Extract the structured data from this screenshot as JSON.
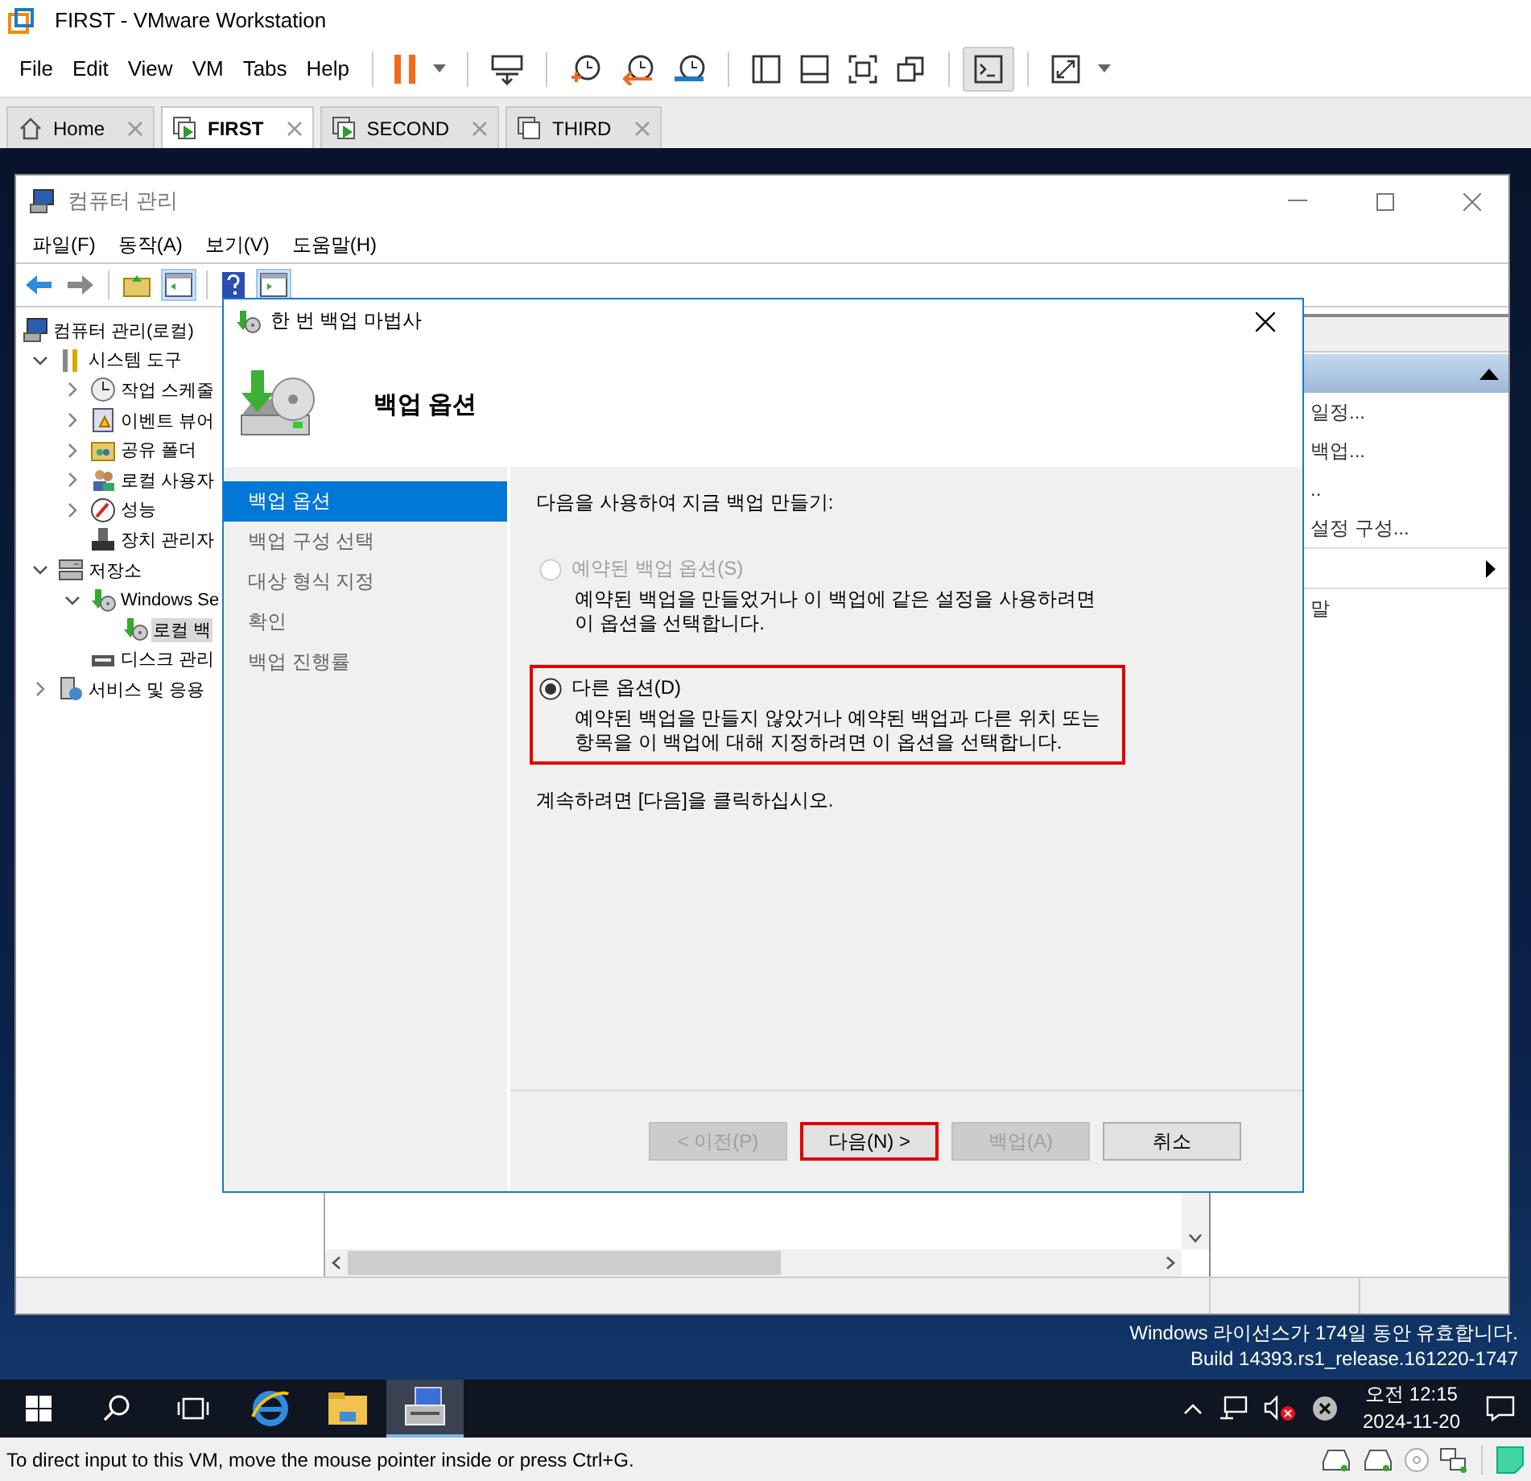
{
  "vmware": {
    "title": "FIRST - VMware Workstation",
    "menu": [
      "File",
      "Edit",
      "View",
      "VM",
      "Tabs",
      "Help"
    ],
    "tabs": [
      {
        "label": "Home",
        "kind": "home",
        "selected": false
      },
      {
        "label": "FIRST",
        "kind": "running",
        "selected": true
      },
      {
        "label": "SECOND",
        "kind": "running",
        "selected": false
      },
      {
        "label": "THIRD",
        "kind": "stopped",
        "selected": false
      }
    ],
    "status": "To direct input to this VM, move the mouse pointer inside or press Ctrl+G."
  },
  "computer_management": {
    "title": "컴퓨터 관리",
    "menu": [
      "파일(F)",
      "동작(A)",
      "보기(V)",
      "도움말(H)"
    ],
    "tree": [
      {
        "label": "컴퓨터 관리(로컬)",
        "kind": "computer",
        "selected": false,
        "children": [
          {
            "label": "시스템 도구",
            "kind": "tools",
            "expanded": true,
            "selected": false,
            "children": [
              {
                "label": "작업 스케줄",
                "kind": "clock",
                "expanded": false,
                "selected": false
              },
              {
                "label": "이벤트 뷰어",
                "kind": "log",
                "expanded": false,
                "selected": false
              },
              {
                "label": "공유 폴더",
                "kind": "share",
                "expanded": false,
                "selected": false
              },
              {
                "label": "로컬 사용자",
                "kind": "users",
                "expanded": false,
                "selected": false
              },
              {
                "label": "성능",
                "kind": "gauge",
                "expanded": false,
                "selected": false
              },
              {
                "label": "장치 관리자",
                "kind": "device",
                "selected": false
              }
            ]
          },
          {
            "label": "저장소",
            "kind": "storage",
            "expanded": true,
            "selected": false,
            "children": [
              {
                "label": "Windows Se",
                "kind": "backup",
                "expanded": true,
                "selected": false,
                "children": [
                  {
                    "label": "로컬 백",
                    "kind": "backup",
                    "selected": true
                  }
                ]
              },
              {
                "label": "디스크 관리",
                "kind": "disk",
                "selected": false
              }
            ]
          },
          {
            "label": "서비스 및 응용",
            "kind": "services",
            "expanded": false,
            "selected": false
          }
        ]
      }
    ],
    "actions": [
      {
        "kind": "section",
        "expanded": true
      },
      {
        "kind": "item",
        "label": "일정..."
      },
      {
        "kind": "item",
        "label": "백업..."
      },
      {
        "kind": "item",
        "label": ".."
      },
      {
        "kind": "item",
        "label": "설정 구성..."
      },
      {
        "kind": "submenu"
      },
      {
        "kind": "item",
        "label": "말"
      }
    ]
  },
  "wizard": {
    "title": "한 번 백업 마법사",
    "heading": "백업 옵션",
    "steps": [
      {
        "label": "백업 옵션",
        "selected": true
      },
      {
        "label": "백업 구성 선택",
        "selected": false
      },
      {
        "label": "대상 형식 지정",
        "selected": false
      },
      {
        "label": "확인",
        "selected": false
      },
      {
        "label": "백업 진행률",
        "selected": false
      }
    ],
    "prompt": "다음을 사용하여 지금 백업 만들기:",
    "options": [
      {
        "label": "예약된 백업 옵션(S)",
        "description": "예약된 백업을 만들었거나 이 백업에 같은 설정을 사용하려면 이 옵션을 선택합니다.",
        "selected": false,
        "disabled": true,
        "highlighted": false
      },
      {
        "label": "다른 옵션(D)",
        "description": "예약된 백업을 만들지 않았거나 예약된 백업과 다른 위치 또는 항목을 이 백업에 대해 지정하려면 이 옵션을 선택합니다.",
        "selected": true,
        "disabled": false,
        "highlighted": true
      }
    ],
    "hint": "계속하려면 [다음]을 클릭하십시오.",
    "buttons": [
      {
        "label": "< 이전(P)",
        "disabled": true,
        "highlighted": false
      },
      {
        "label": "다음(N) >",
        "disabled": false,
        "highlighted": true
      },
      {
        "label": "백업(A)",
        "disabled": true,
        "highlighted": false
      },
      {
        "label": "취소",
        "disabled": false,
        "highlighted": false
      }
    ]
  },
  "desktop": {
    "license": "Windows 라이선스가 174일 동안 유효합니다.",
    "build": "Build 14393.rs1_release.161220-1747"
  },
  "taskbar": {
    "apps": [
      {
        "kind": "browser",
        "active": false
      },
      {
        "kind": "folder",
        "active": false
      },
      {
        "kind": "server-manager",
        "active": true
      }
    ],
    "time": "오전 12:15",
    "date": "2024-11-20"
  }
}
